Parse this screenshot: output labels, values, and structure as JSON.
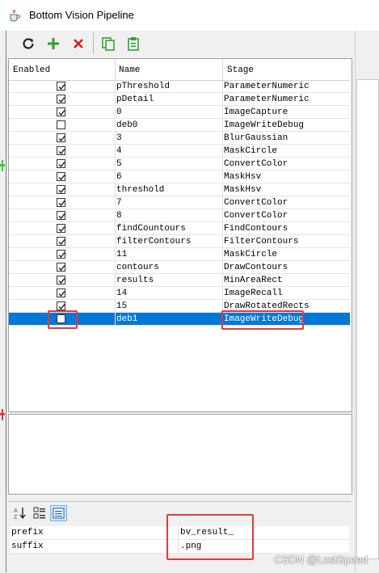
{
  "window": {
    "title": "Bottom Vision Pipeline",
    "icon": "java-cup-icon"
  },
  "toolbar": {
    "buttons": [
      {
        "name": "refresh-button",
        "icon": "refresh-icon"
      },
      {
        "name": "add-stage-button",
        "icon": "plus-icon"
      },
      {
        "name": "remove-stage-button",
        "icon": "x-icon"
      },
      {
        "name": "copy-button",
        "icon": "copy-icon"
      },
      {
        "name": "paste-button",
        "icon": "paste-icon"
      }
    ]
  },
  "table": {
    "headers": {
      "enabled": "Enabled",
      "name": "Name",
      "stage": "Stage"
    },
    "rows": [
      {
        "enabled": true,
        "name": "pThreshold",
        "stage": "ParameterNumeric"
      },
      {
        "enabled": true,
        "name": "pDetail",
        "stage": "ParameterNumeric"
      },
      {
        "enabled": true,
        "name": "0",
        "stage": "ImageCapture"
      },
      {
        "enabled": false,
        "name": "deb0",
        "stage": "ImageWriteDebug"
      },
      {
        "enabled": true,
        "name": "3",
        "stage": "BlurGaussian"
      },
      {
        "enabled": true,
        "name": "4",
        "stage": "MaskCircle"
      },
      {
        "enabled": true,
        "name": "5",
        "stage": "ConvertColor"
      },
      {
        "enabled": true,
        "name": "6",
        "stage": "MaskHsv"
      },
      {
        "enabled": true,
        "name": "threshold",
        "stage": "MaskHsv"
      },
      {
        "enabled": true,
        "name": "7",
        "stage": "ConvertColor"
      },
      {
        "enabled": true,
        "name": "8",
        "stage": "ConvertColor"
      },
      {
        "enabled": true,
        "name": "findCountours",
        "stage": "FindContours"
      },
      {
        "enabled": true,
        "name": "filterContours",
        "stage": "FilterContours"
      },
      {
        "enabled": true,
        "name": "11",
        "stage": "MaskCircle"
      },
      {
        "enabled": true,
        "name": "contours",
        "stage": "DrawContours"
      },
      {
        "enabled": true,
        "name": "results",
        "stage": "MinAreaRect"
      },
      {
        "enabled": true,
        "name": "14",
        "stage": "ImageRecall"
      },
      {
        "enabled": true,
        "name": "15",
        "stage": "DrawRotatedRects"
      },
      {
        "enabled": false,
        "name": "deb1",
        "stage": "ImageWriteDebug",
        "selected": true
      }
    ]
  },
  "properties": {
    "toolbar": [
      {
        "name": "sort-alpha-button",
        "icon": "sort-az-icon"
      },
      {
        "name": "categorized-button",
        "icon": "categorized-icon"
      },
      {
        "name": "property-pages-button",
        "icon": "property-pages-icon"
      }
    ],
    "rows": [
      {
        "key": "prefix",
        "value": "bv_result_"
      },
      {
        "key": "suffix",
        "value": ".png"
      }
    ]
  },
  "watermark": "CSDN @LostSpeed",
  "colors": {
    "selection": "#0078d7",
    "highlight_box": "#e23a3a",
    "add_green": "#2e9e2e",
    "remove_red": "#d42020"
  }
}
